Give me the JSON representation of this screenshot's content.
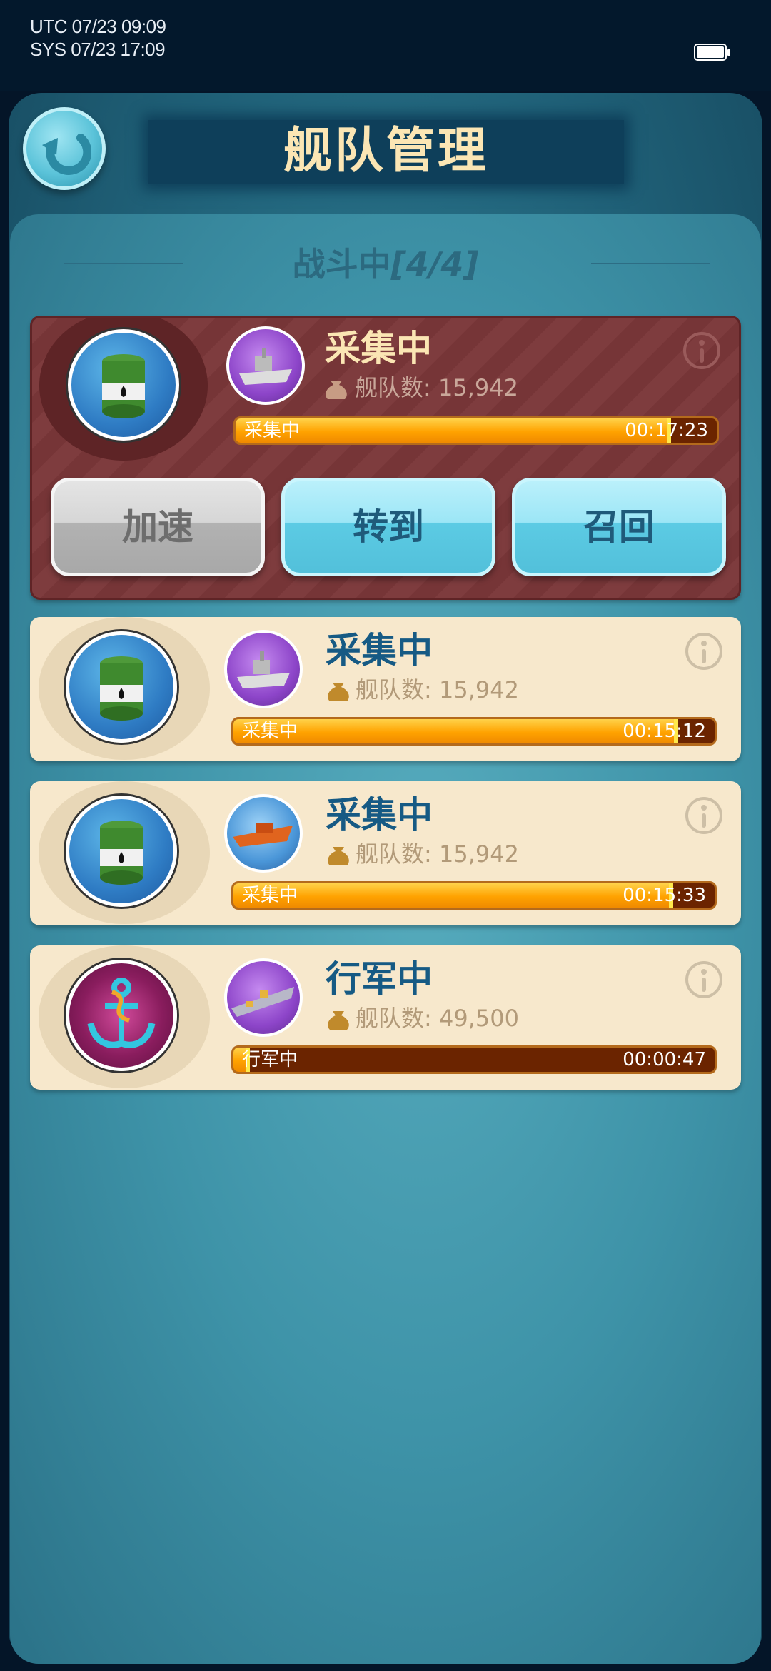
{
  "status_bar": {
    "utc": "UTC 07/23 09:09",
    "sys": "SYS 07/23 17:09"
  },
  "header": {
    "title": "舰队管理"
  },
  "section": {
    "label": "战斗中",
    "count": "[4/4]"
  },
  "fleets": [
    {
      "state": "采集中",
      "fleet_label": "舰队数:",
      "fleet_count": "15,942",
      "bar_label": "采集中",
      "time": "00:17:23",
      "progress": 0.9,
      "resource_icon": "oil-barrel-icon",
      "ship_icon": "cruiser-ship-icon",
      "actions": [
        "加速",
        "转到",
        "召回"
      ]
    },
    {
      "state": "采集中",
      "fleet_label": "舰队数:",
      "fleet_count": "15,942",
      "bar_label": "采集中",
      "time": "00:15:12",
      "progress": 0.92,
      "resource_icon": "oil-barrel-icon",
      "ship_icon": "cruiser-ship-icon"
    },
    {
      "state": "采集中",
      "fleet_label": "舰队数:",
      "fleet_count": "15,942",
      "bar_label": "采集中",
      "time": "00:15:33",
      "progress": 0.91,
      "resource_icon": "oil-barrel-icon",
      "ship_icon": "gunboat-ship-icon"
    },
    {
      "state": "行军中",
      "fleet_label": "舰队数:",
      "fleet_count": "49,500",
      "bar_label": "行军中",
      "time": "00:00:47",
      "progress": 0.03,
      "resource_icon": "anchor-icon",
      "ship_icon": "carrier-ship-icon"
    }
  ],
  "colors": {
    "title": "#fbe6b4",
    "state_text": "#165a84",
    "progress_fill": "#ffa200",
    "progress_track": "#6b2400",
    "selected_card": "#7e3c3e",
    "card": "#f7e8cc"
  }
}
